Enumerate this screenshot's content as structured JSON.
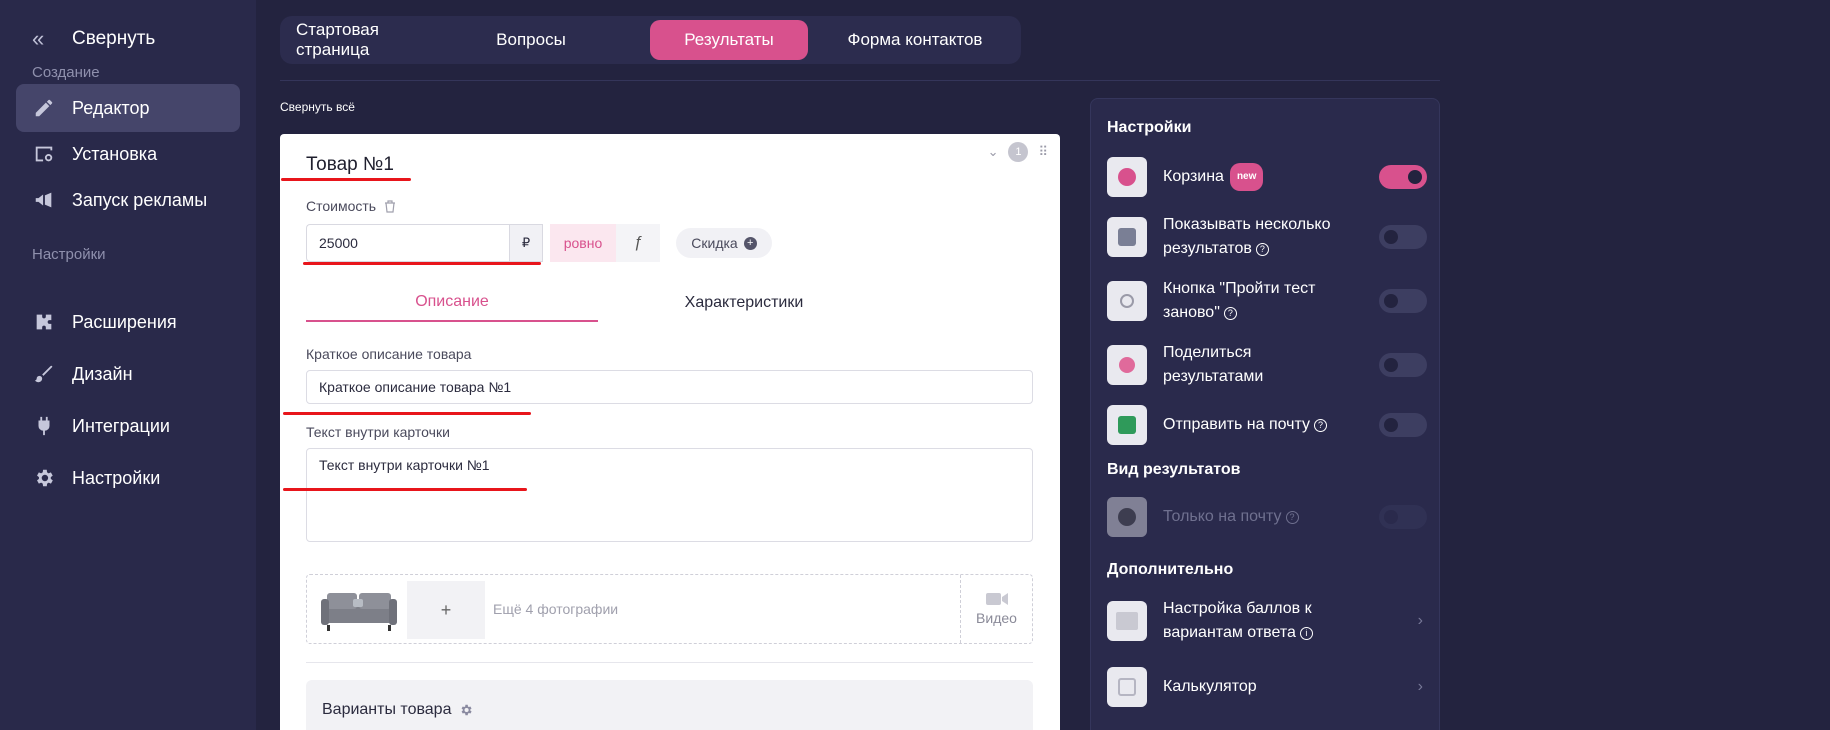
{
  "sidebar": {
    "collapse_label": "Свернуть",
    "section_create": "Создание",
    "section_settings": "Настройки",
    "items": [
      {
        "label": "Редактор",
        "icon": "pencil-icon",
        "active": true
      },
      {
        "label": "Установка",
        "icon": "install-icon"
      },
      {
        "label": "Запуск рекламы",
        "icon": "megaphone-icon"
      },
      {
        "label": "Расширения",
        "icon": "puzzle-icon"
      },
      {
        "label": "Дизайн",
        "icon": "brush-icon"
      },
      {
        "label": "Интеграции",
        "icon": "plug-icon"
      },
      {
        "label": "Настройки",
        "icon": "gear-icon"
      }
    ]
  },
  "tabs": [
    {
      "label": "Стартовая страница"
    },
    {
      "label": "Вопросы"
    },
    {
      "label": "Результаты",
      "active": true
    },
    {
      "label": "Форма контактов"
    }
  ],
  "collapse_all": "Свернуть всё",
  "card": {
    "title": "Товар №1",
    "index": "1",
    "price_label": "Стоимость",
    "price_value": "25000",
    "currency": "₽",
    "mode_exact": "ровно",
    "mode_formula": "ƒ",
    "discount_label": "Скидка",
    "content_tabs": [
      "Описание",
      "Характеристики"
    ],
    "short_desc_label": "Краткое описание товара",
    "short_desc_value": "Краткое описание товара №1",
    "inner_text_label": "Текст внутри карточки",
    "inner_text_value": "Текст внутри карточки №1",
    "add_photo": "+",
    "more_photos": "Ещё 4 фотографии",
    "video_label": "Видео",
    "variants_label": "Варианты товара"
  },
  "panel": {
    "heading_settings": "Настройки",
    "heading_view": "Вид результатов",
    "heading_extra": "Дополнительно",
    "new_badge": "new",
    "help_glyph": "?",
    "info_glyph": "i",
    "settings": [
      {
        "label": "Корзина",
        "on": true
      },
      {
        "label": "Показывать несколько результатов",
        "on": false
      },
      {
        "label": "Кнопка \"Пройти тест заново\"",
        "on": false
      },
      {
        "label": "Поделиться результатами",
        "on": false
      },
      {
        "label": "Отправить на почту",
        "on": false
      }
    ],
    "view": [
      {
        "label": "Только на почту",
        "on": false,
        "disabled": true
      }
    ],
    "extra": [
      {
        "label": "Настройка баллов к вариантам ответа"
      },
      {
        "label": "Калькулятор"
      }
    ]
  },
  "colors": {
    "accent": "#d8518d",
    "bg": "#23233f",
    "sidebar": "#29294a",
    "annotation": "#e8151b"
  }
}
